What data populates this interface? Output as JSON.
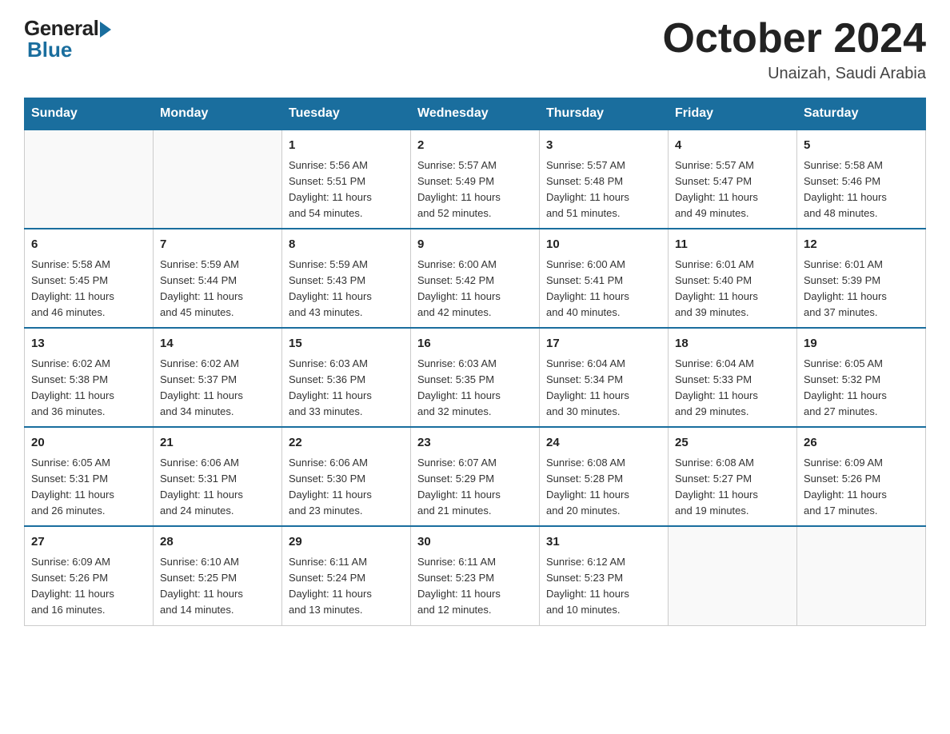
{
  "header": {
    "logo_text_general": "General",
    "logo_text_blue": "Blue",
    "month_title": "October 2024",
    "location": "Unaizah, Saudi Arabia"
  },
  "days_of_week": [
    "Sunday",
    "Monday",
    "Tuesday",
    "Wednesday",
    "Thursday",
    "Friday",
    "Saturday"
  ],
  "weeks": [
    [
      {
        "day": "",
        "info": ""
      },
      {
        "day": "",
        "info": ""
      },
      {
        "day": "1",
        "info": "Sunrise: 5:56 AM\nSunset: 5:51 PM\nDaylight: 11 hours\nand 54 minutes."
      },
      {
        "day": "2",
        "info": "Sunrise: 5:57 AM\nSunset: 5:49 PM\nDaylight: 11 hours\nand 52 minutes."
      },
      {
        "day": "3",
        "info": "Sunrise: 5:57 AM\nSunset: 5:48 PM\nDaylight: 11 hours\nand 51 minutes."
      },
      {
        "day": "4",
        "info": "Sunrise: 5:57 AM\nSunset: 5:47 PM\nDaylight: 11 hours\nand 49 minutes."
      },
      {
        "day": "5",
        "info": "Sunrise: 5:58 AM\nSunset: 5:46 PM\nDaylight: 11 hours\nand 48 minutes."
      }
    ],
    [
      {
        "day": "6",
        "info": "Sunrise: 5:58 AM\nSunset: 5:45 PM\nDaylight: 11 hours\nand 46 minutes."
      },
      {
        "day": "7",
        "info": "Sunrise: 5:59 AM\nSunset: 5:44 PM\nDaylight: 11 hours\nand 45 minutes."
      },
      {
        "day": "8",
        "info": "Sunrise: 5:59 AM\nSunset: 5:43 PM\nDaylight: 11 hours\nand 43 minutes."
      },
      {
        "day": "9",
        "info": "Sunrise: 6:00 AM\nSunset: 5:42 PM\nDaylight: 11 hours\nand 42 minutes."
      },
      {
        "day": "10",
        "info": "Sunrise: 6:00 AM\nSunset: 5:41 PM\nDaylight: 11 hours\nand 40 minutes."
      },
      {
        "day": "11",
        "info": "Sunrise: 6:01 AM\nSunset: 5:40 PM\nDaylight: 11 hours\nand 39 minutes."
      },
      {
        "day": "12",
        "info": "Sunrise: 6:01 AM\nSunset: 5:39 PM\nDaylight: 11 hours\nand 37 minutes."
      }
    ],
    [
      {
        "day": "13",
        "info": "Sunrise: 6:02 AM\nSunset: 5:38 PM\nDaylight: 11 hours\nand 36 minutes."
      },
      {
        "day": "14",
        "info": "Sunrise: 6:02 AM\nSunset: 5:37 PM\nDaylight: 11 hours\nand 34 minutes."
      },
      {
        "day": "15",
        "info": "Sunrise: 6:03 AM\nSunset: 5:36 PM\nDaylight: 11 hours\nand 33 minutes."
      },
      {
        "day": "16",
        "info": "Sunrise: 6:03 AM\nSunset: 5:35 PM\nDaylight: 11 hours\nand 32 minutes."
      },
      {
        "day": "17",
        "info": "Sunrise: 6:04 AM\nSunset: 5:34 PM\nDaylight: 11 hours\nand 30 minutes."
      },
      {
        "day": "18",
        "info": "Sunrise: 6:04 AM\nSunset: 5:33 PM\nDaylight: 11 hours\nand 29 minutes."
      },
      {
        "day": "19",
        "info": "Sunrise: 6:05 AM\nSunset: 5:32 PM\nDaylight: 11 hours\nand 27 minutes."
      }
    ],
    [
      {
        "day": "20",
        "info": "Sunrise: 6:05 AM\nSunset: 5:31 PM\nDaylight: 11 hours\nand 26 minutes."
      },
      {
        "day": "21",
        "info": "Sunrise: 6:06 AM\nSunset: 5:31 PM\nDaylight: 11 hours\nand 24 minutes."
      },
      {
        "day": "22",
        "info": "Sunrise: 6:06 AM\nSunset: 5:30 PM\nDaylight: 11 hours\nand 23 minutes."
      },
      {
        "day": "23",
        "info": "Sunrise: 6:07 AM\nSunset: 5:29 PM\nDaylight: 11 hours\nand 21 minutes."
      },
      {
        "day": "24",
        "info": "Sunrise: 6:08 AM\nSunset: 5:28 PM\nDaylight: 11 hours\nand 20 minutes."
      },
      {
        "day": "25",
        "info": "Sunrise: 6:08 AM\nSunset: 5:27 PM\nDaylight: 11 hours\nand 19 minutes."
      },
      {
        "day": "26",
        "info": "Sunrise: 6:09 AM\nSunset: 5:26 PM\nDaylight: 11 hours\nand 17 minutes."
      }
    ],
    [
      {
        "day": "27",
        "info": "Sunrise: 6:09 AM\nSunset: 5:26 PM\nDaylight: 11 hours\nand 16 minutes."
      },
      {
        "day": "28",
        "info": "Sunrise: 6:10 AM\nSunset: 5:25 PM\nDaylight: 11 hours\nand 14 minutes."
      },
      {
        "day": "29",
        "info": "Sunrise: 6:11 AM\nSunset: 5:24 PM\nDaylight: 11 hours\nand 13 minutes."
      },
      {
        "day": "30",
        "info": "Sunrise: 6:11 AM\nSunset: 5:23 PM\nDaylight: 11 hours\nand 12 minutes."
      },
      {
        "day": "31",
        "info": "Sunrise: 6:12 AM\nSunset: 5:23 PM\nDaylight: 11 hours\nand 10 minutes."
      },
      {
        "day": "",
        "info": ""
      },
      {
        "day": "",
        "info": ""
      }
    ]
  ]
}
